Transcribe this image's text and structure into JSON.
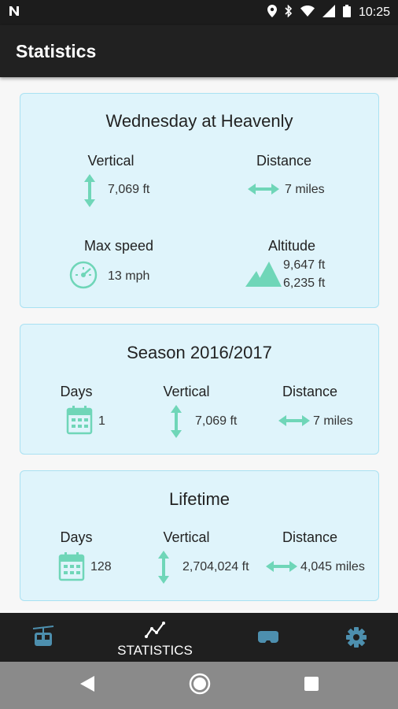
{
  "status_bar": {
    "carrier_icon": "n-logo-icon",
    "time": "10:25"
  },
  "app_bar": {
    "title": "Statistics"
  },
  "cards": {
    "today": {
      "title": "Wednesday at Heavenly",
      "vertical": {
        "label": "Vertical",
        "value": "7,069 ft"
      },
      "distance": {
        "label": "Distance",
        "value": "7 miles"
      },
      "max_speed": {
        "label": "Max speed",
        "value": "13 mph"
      },
      "altitude": {
        "label": "Altitude",
        "max": "9,647 ft",
        "min": "6,235 ft"
      }
    },
    "season": {
      "title": "Season 2016/2017",
      "days": {
        "label": "Days",
        "value": "1"
      },
      "vertical": {
        "label": "Vertical",
        "value": "7,069 ft"
      },
      "distance": {
        "label": "Distance",
        "value": "7 miles"
      }
    },
    "lifetime": {
      "title": "Lifetime",
      "days": {
        "label": "Days",
        "value": "128"
      },
      "vertical": {
        "label": "Vertical",
        "value": "2,704,024 ft"
      },
      "distance": {
        "label": "Distance",
        "value": "4,045 miles"
      }
    }
  },
  "bottom_nav": {
    "active": "statistics",
    "statistics_label": "STATISTICS"
  },
  "colors": {
    "accent": "#6fd6b8",
    "card_bg": "#dff4fb",
    "card_border": "#a9e1f2",
    "nav_icon": "#4d8fae"
  }
}
